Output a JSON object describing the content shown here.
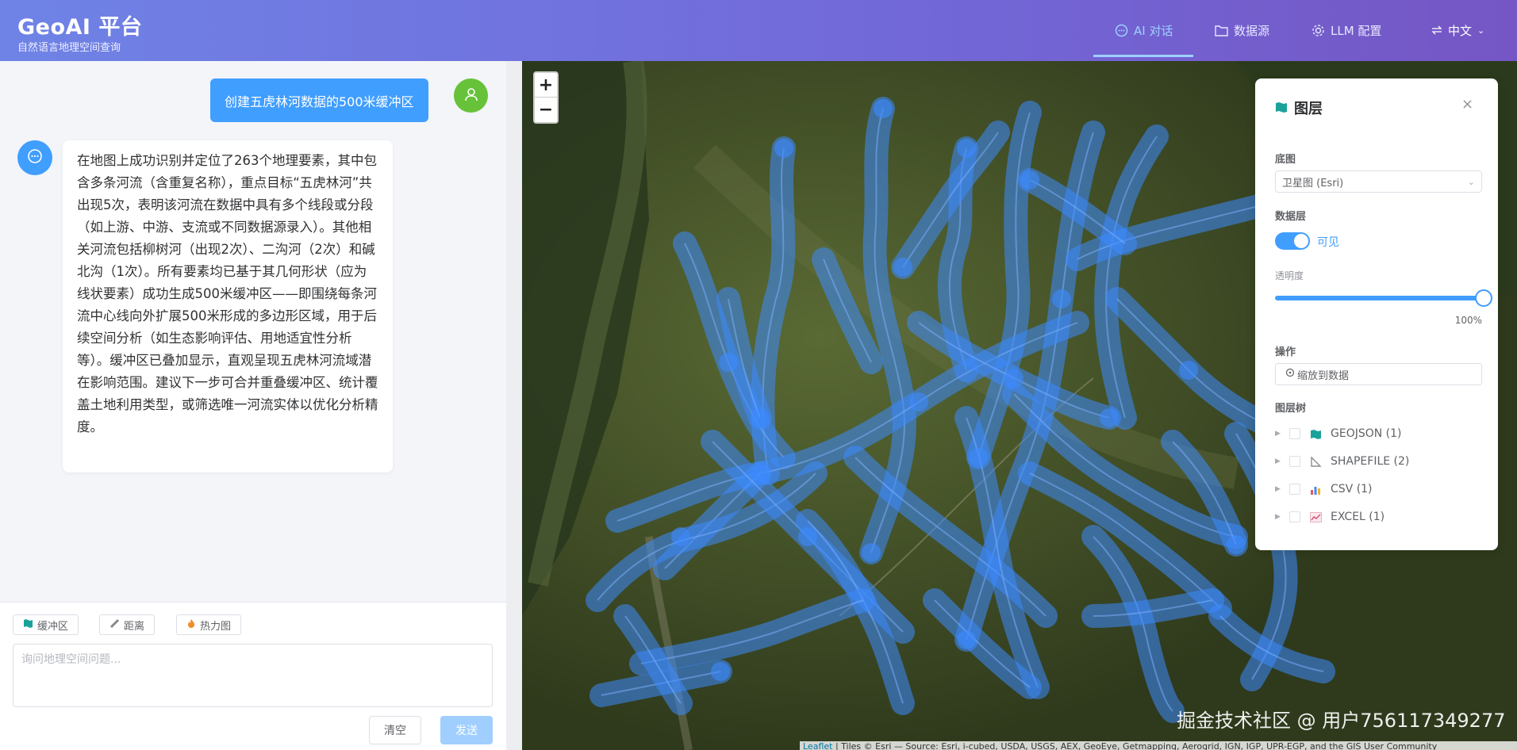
{
  "header": {
    "title": "GeoAI 平台",
    "subtitle": "自然语言地理空间查询",
    "nav": [
      {
        "label": "AI 对话",
        "icon": "chat-icon",
        "active": true
      },
      {
        "label": "数据源",
        "icon": "folder-icon",
        "active": false
      },
      {
        "label": "LLM 配置",
        "icon": "gear-icon",
        "active": false
      }
    ],
    "language": "中文",
    "accent_color": "#9fd0ff"
  },
  "chat": {
    "user_message": "创建五虎林河数据的500米缓冲区",
    "ai_message": "在地图上成功识别并定位了263个地理要素，其中包含多条河流（含重复名称），重点目标“五虎林河”共出现5次，表明该河流在数据中具有多个线段或分段（如上游、中游、支流或不同数据源录入）。其他相关河流包括柳树河（出现2次）、二沟河（2次）和碱北沟（1次）。所有要素均已基于其几何形状（应为线状要素）成功生成500米缓冲区——即围绕每条河流中心线向外扩展500米形成的多边形区域，用于后续空间分析（如生态影响评估、用地适宜性分析等）。缓冲区已叠加显示，直观呈现五虎林河流域潜在影响范围。建议下一步可合并重叠缓冲区、统计覆盖土地利用类型，或筛选唯一河流实体以优化分析精度。",
    "tools": [
      {
        "label": "缓冲区",
        "icon": "map-icon"
      },
      {
        "label": "距离",
        "icon": "ruler-icon"
      },
      {
        "label": "热力图",
        "icon": "fire-icon"
      }
    ],
    "input_placeholder": "询问地理空间问题...",
    "clear_label": "清空",
    "send_label": "发送"
  },
  "map": {
    "zoom_in": "+",
    "zoom_out": "−",
    "watermark": "掘金技术社区 @ 用户756117349277",
    "attribution_leaflet": "Leaflet",
    "attribution_text": " | Tiles © Esri — Source: Esri, i-cubed, USDA, USGS, AEX, GeoEye, Getmapping, Aerogrid, IGN, IGP, UPR-EGP, and the GIS User Community",
    "buffer_color": "#3d8bff"
  },
  "layers_panel": {
    "title": "图层",
    "close": "×",
    "basemap_label": "底图",
    "basemap_value": "卫星图 (Esri)",
    "data_layer_label": "数据层",
    "visible_label": "可见",
    "visible": true,
    "opacity_label": "透明度",
    "opacity": 1.0,
    "opacity_text": "100%",
    "actions_label": "操作",
    "zoom_to_data": "缩放到数据",
    "tree_label": "图层树",
    "tree": [
      {
        "label": "GEOJSON (1)",
        "icon": "map-icon"
      },
      {
        "label": "SHAPEFILE (2)",
        "icon": "ruler-triangle-icon"
      },
      {
        "label": "CSV (1)",
        "icon": "bar-chart-icon"
      },
      {
        "label": "EXCEL (1)",
        "icon": "line-chart-icon"
      }
    ]
  }
}
